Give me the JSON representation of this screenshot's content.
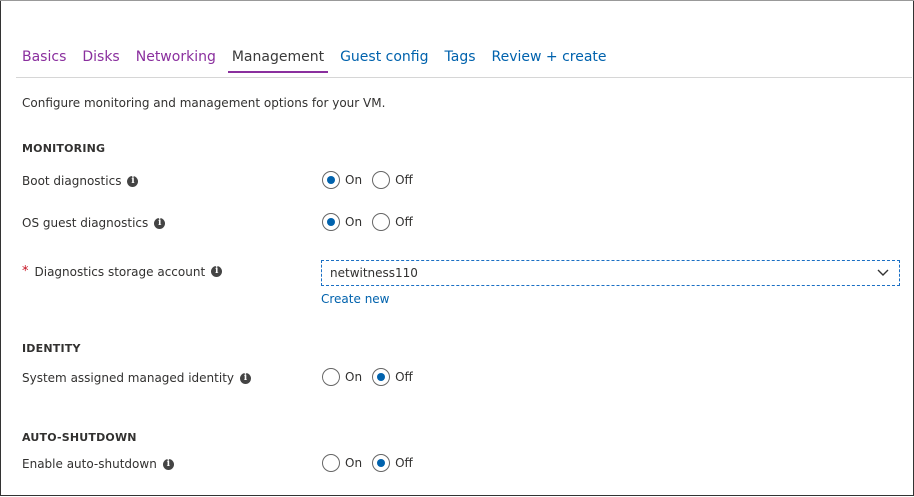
{
  "tabs": [
    {
      "label": "Basics",
      "color": "#8a2f9e"
    },
    {
      "label": "Disks",
      "color": "#8a2f9e"
    },
    {
      "label": "Networking",
      "color": "#8a2f9e"
    },
    {
      "label": "Management",
      "active": true
    },
    {
      "label": "Guest config",
      "color": "#0062ad"
    },
    {
      "label": "Tags",
      "color": "#0062ad"
    },
    {
      "label": "Review + create",
      "color": "#0062ad"
    }
  ],
  "description": "Configure monitoring and management options for your VM.",
  "sections": {
    "monitoring": "MONITORING",
    "identity": "IDENTITY",
    "auto_shutdown": "AUTO-SHUTDOWN"
  },
  "fields": {
    "boot_diagnostics": {
      "label": "Boot diagnostics",
      "selected": "On"
    },
    "os_guest_diagnostics": {
      "label": "OS guest diagnostics",
      "selected": "On"
    },
    "diagnostics_storage": {
      "label": "Diagnostics storage account",
      "required_mark": "*",
      "value": "netwitness110",
      "create_new": "Create new"
    },
    "system_identity": {
      "label": "System assigned managed identity",
      "selected": "Off"
    },
    "auto_shutdown": {
      "label": "Enable auto-shutdown",
      "selected": "Off"
    }
  },
  "options": {
    "on": "On",
    "off": "Off"
  },
  "icons": {
    "info": "info-icon",
    "dropdown": "chevron-down-icon"
  },
  "colors": {
    "accent": "#0062ad",
    "tab_visited": "#8a2f9e",
    "required": "#c50f1f"
  }
}
